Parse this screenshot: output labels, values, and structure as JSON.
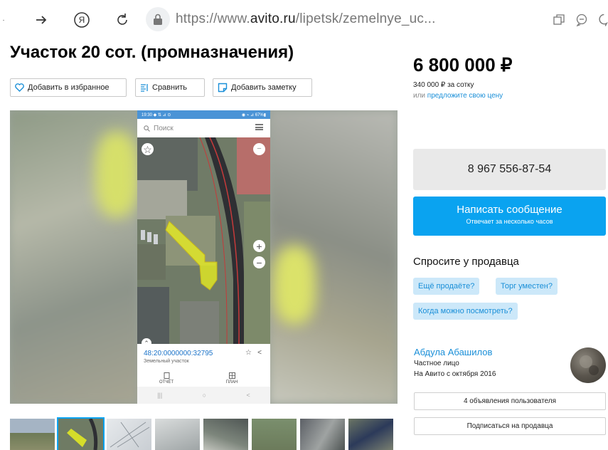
{
  "browser": {
    "url_prefix": "https://www.",
    "url_domain": "avito.ru",
    "url_path": "/lipetsk/zemelnye_uc...",
    "ya_glyph": "Я"
  },
  "listing": {
    "title": "Участок 20 сот. (промназначения)",
    "actions": {
      "favorite": "Добавить в избранное",
      "compare": "Сравнить",
      "note": "Добавить заметку"
    }
  },
  "photo": {
    "status_left": "19:30 ◆ ⇅ ⊿ ⊙",
    "status_right": "◉ ⌁ ⊿ 67%▮",
    "search_placeholder": "Поиск",
    "cadastral_number": "48:20:0000000:32795",
    "parcel_type": "Земельный участок",
    "report_label": "ОТЧЁТ",
    "plan_label": "ПЛАН",
    "nav_glyphs": [
      "|||",
      "○",
      "<"
    ]
  },
  "price": {
    "value": "6 800 000 ₽",
    "per_unit": "340 000 ₽ за сотку",
    "offer_prefix": "или ",
    "offer_link": "предложите свою цену"
  },
  "contact": {
    "phone": "8 967 556-87-54",
    "message_title": "Написать сообщение",
    "message_sub": "Отвечает за несколько часов"
  },
  "ask": {
    "heading": "Спросите у продавца",
    "chips": [
      "Ещё продаёте?",
      "Торг уместен?",
      "Когда можно посмотреть?"
    ]
  },
  "seller": {
    "name": "Абдула Абашилов",
    "type": "Частное лицо",
    "since": "На Авито с октября 2016",
    "listings_button": "4 объявления пользователя",
    "subscribe_button": "Подписаться на продавца"
  },
  "colors": {
    "accent": "#0aa3f0",
    "link": "#1a8fd8",
    "chip_bg": "#cce8f9",
    "parcel": "#e8ee20"
  }
}
